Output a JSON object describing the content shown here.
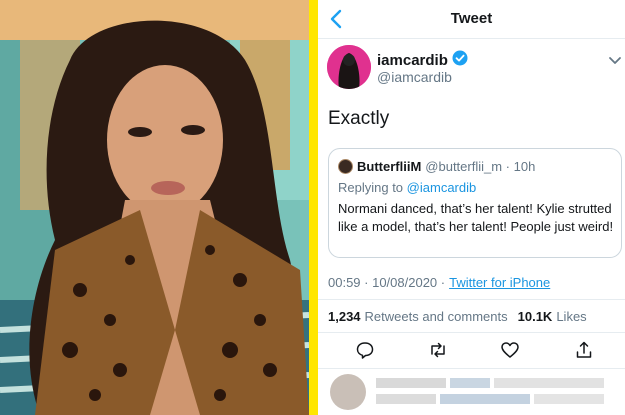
{
  "header": {
    "title": "Tweet"
  },
  "tweet": {
    "display_name": "iamcardib",
    "handle": "@iamcardib",
    "text": "Exactly",
    "quoted": {
      "display_name": "ButterfliiM",
      "handle_time": "@butterflii_m · 10h",
      "replying_prefix": "Replying to",
      "replying_to": "@iamcardib",
      "text": "Normani danced, that’s her talent! Kylie strutted like a model, that’s her talent! People just weird!"
    },
    "timestamp": "00:59 · 10/08/2020 ·",
    "source": "Twitter for iPhone",
    "stats": {
      "retweets_count": "1,234",
      "retweets_label": "Retweets and comments",
      "likes_count": "10.1K",
      "likes_label": "Likes"
    }
  },
  "icons": [
    "back-chevron-icon",
    "verified-badge-icon",
    "more-caret-icon",
    "reply-icon",
    "retweet-icon",
    "like-icon",
    "share-icon"
  ],
  "colors": {
    "accent": "#1da1f2",
    "divider": "#ffe600",
    "link": "#1b95e0"
  }
}
